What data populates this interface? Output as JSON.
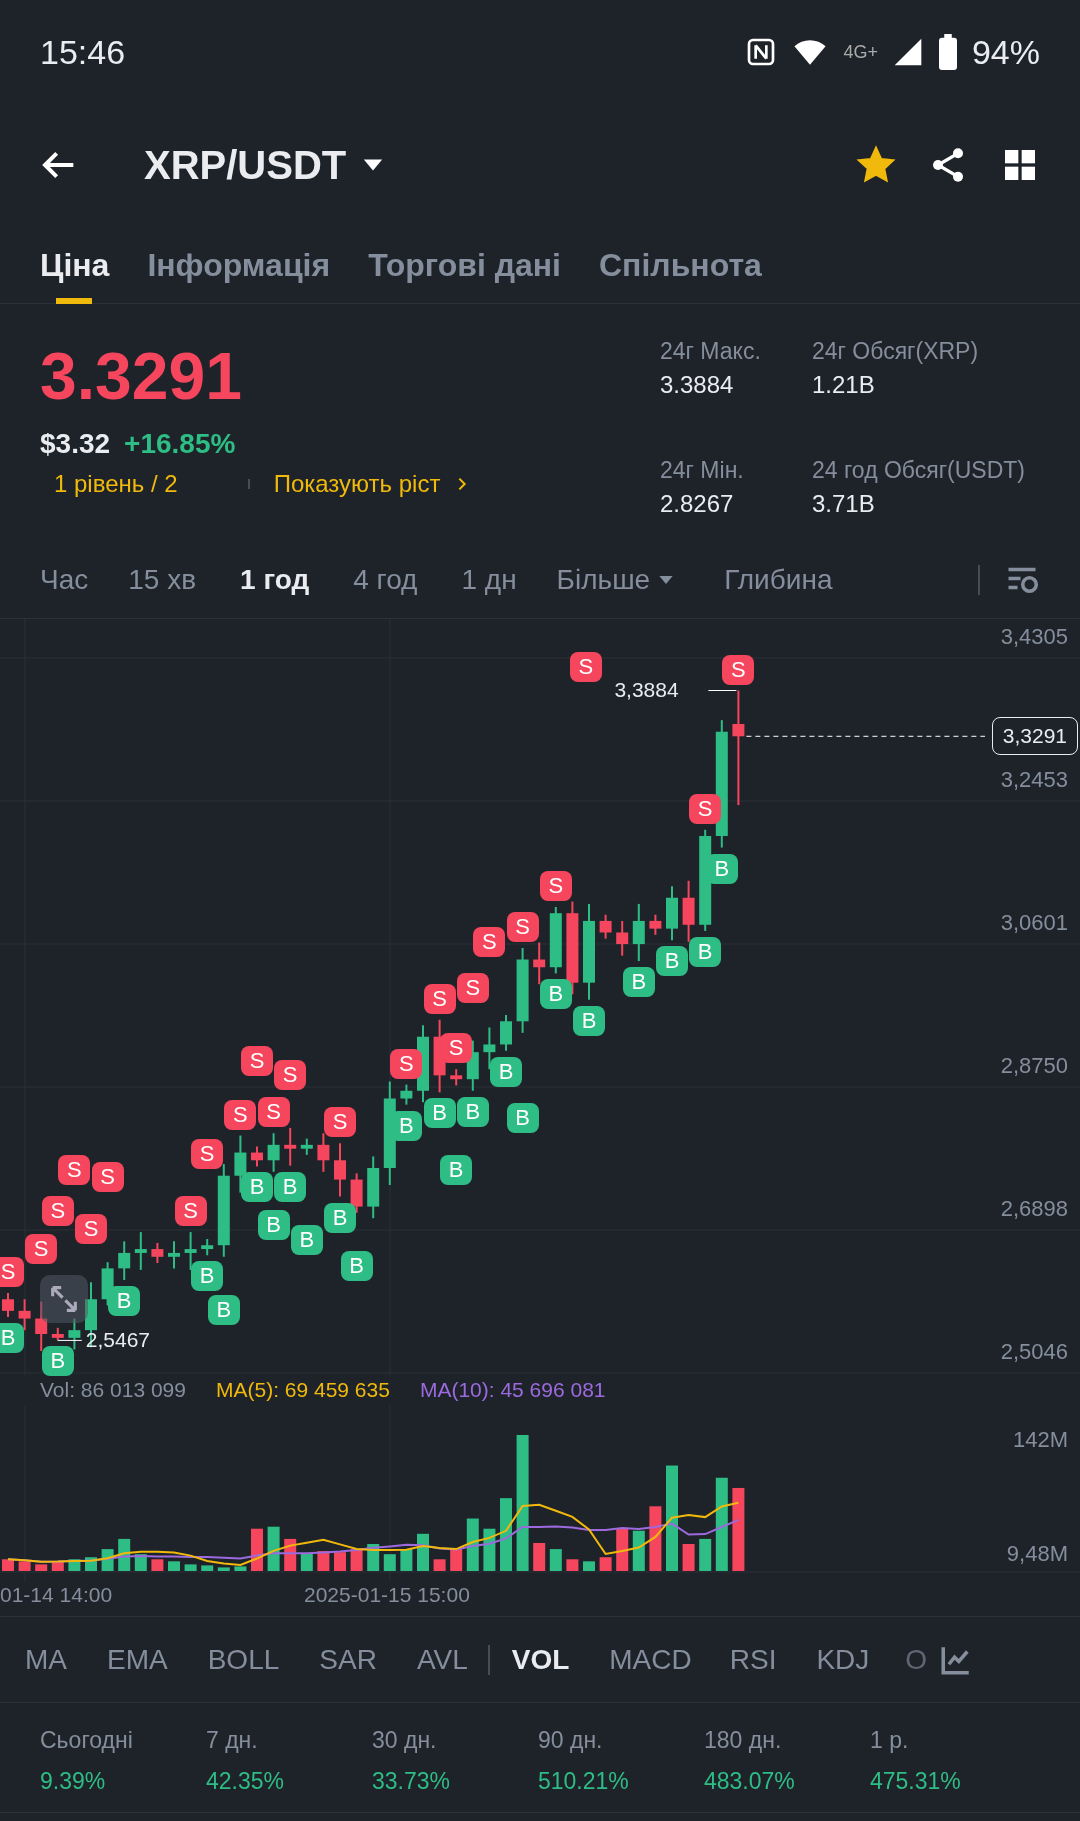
{
  "status_bar": {
    "time": "15:46",
    "network": "4G+",
    "battery": "94%"
  },
  "header": {
    "title": "XRP/USDT",
    "favorite": true
  },
  "tabs": [
    {
      "label": "Ціна",
      "selected": true
    },
    {
      "label": "Інформація",
      "selected": false
    },
    {
      "label": "Торгові дані",
      "selected": false
    },
    {
      "label": "Спільнота",
      "selected": false
    }
  ],
  "price": {
    "last": "3.3291",
    "usd": "$3.32",
    "change": "+16.85%",
    "level_text": "1 рівень / 2",
    "trend_link": "Показують ріст"
  },
  "stats": [
    {
      "label": "24г Макс.",
      "value": "3.3884"
    },
    {
      "label": "24г Обсяг(XRP)",
      "value": "1.21B"
    },
    {
      "label": "24г Мін.",
      "value": "2.8267"
    },
    {
      "label": "24 год Обсяг(USDT)",
      "value": "3.71B"
    }
  ],
  "intervals": [
    {
      "label": "Час",
      "selected": false
    },
    {
      "label": "15 хв",
      "selected": false
    },
    {
      "label": "1 год",
      "selected": true
    },
    {
      "label": "4 год",
      "selected": false
    },
    {
      "label": "1 дн",
      "selected": false
    },
    {
      "label": "Більше",
      "selected": false,
      "dropdown": true
    },
    {
      "label": "Глибина",
      "selected": false
    }
  ],
  "price_axis": [
    "3,4305",
    "3,2453",
    "3,0601",
    "2,8750",
    "2,6898",
    "2,5046"
  ],
  "current_price_tag": "3,3291",
  "high_label": "3,3884",
  "low_label": "2,5467",
  "trade_markers": [
    {
      "kind": "sell",
      "label": "S"
    },
    {
      "kind": "buy",
      "label": "B"
    },
    {
      "kind": "sell",
      "label": "S"
    },
    {
      "kind": "sell",
      "label": "S"
    },
    {
      "kind": "buy",
      "label": "B"
    },
    {
      "kind": "sell",
      "label": "S"
    },
    {
      "kind": "sell",
      "label": "S"
    },
    {
      "kind": "sell",
      "label": "S"
    },
    {
      "kind": "buy",
      "label": "B"
    },
    {
      "kind": "sell",
      "label": "S"
    },
    {
      "kind": "sell",
      "label": "S"
    },
    {
      "kind": "buy",
      "label": "B"
    },
    {
      "kind": "buy",
      "label": "B"
    },
    {
      "kind": "sell",
      "label": "S"
    },
    {
      "kind": "sell",
      "label": "S"
    },
    {
      "kind": "buy",
      "label": "B"
    },
    {
      "kind": "sell",
      "label": "S"
    },
    {
      "kind": "buy",
      "label": "B"
    },
    {
      "kind": "sell",
      "label": "S"
    },
    {
      "kind": "buy",
      "label": "B"
    },
    {
      "kind": "buy",
      "label": "B"
    },
    {
      "kind": "sell",
      "label": "S"
    },
    {
      "kind": "buy",
      "label": "B"
    },
    {
      "kind": "buy",
      "label": "B"
    },
    {
      "kind": "sell",
      "label": "S"
    },
    {
      "kind": "buy",
      "label": "B"
    },
    {
      "kind": "sell",
      "label": "S"
    },
    {
      "kind": "buy",
      "label": "B"
    },
    {
      "kind": "sell",
      "label": "S"
    },
    {
      "kind": "buy",
      "label": "B"
    },
    {
      "kind": "buy",
      "label": "B"
    },
    {
      "kind": "sell",
      "label": "S"
    },
    {
      "kind": "sell",
      "label": "S"
    },
    {
      "kind": "buy",
      "label": "B"
    },
    {
      "kind": "buy",
      "label": "B"
    },
    {
      "kind": "sell",
      "label": "S"
    },
    {
      "kind": "buy",
      "label": "B"
    },
    {
      "kind": "buy",
      "label": "B"
    },
    {
      "kind": "buy",
      "label": "B"
    },
    {
      "kind": "buy",
      "label": "B"
    },
    {
      "kind": "sell",
      "label": "S"
    },
    {
      "kind": "buy",
      "label": "B"
    },
    {
      "kind": "sell",
      "label": "S"
    },
    {
      "kind": "buy",
      "label": "B"
    },
    {
      "kind": "sell",
      "label": "S"
    },
    {
      "kind": "sell",
      "label": "S"
    }
  ],
  "volume_legend": {
    "vol": "Vol: 86 013 099",
    "ma5": "MA(5): 69 459 635",
    "ma10": "MA(10): 45 696 081"
  },
  "volume_axis": [
    "142M",
    "9,48M"
  ],
  "time_axis": [
    "01-14 14:00",
    "2025-01-15 15:00"
  ],
  "indicators": [
    {
      "label": "MA",
      "selected": false
    },
    {
      "label": "EMA",
      "selected": false
    },
    {
      "label": "BOLL",
      "selected": false
    },
    {
      "label": "SAR",
      "selected": false
    },
    {
      "label": "AVL",
      "selected": false
    },
    {
      "label": "VOL",
      "selected": true
    },
    {
      "label": "MACD",
      "selected": false
    },
    {
      "label": "RSI",
      "selected": false
    },
    {
      "label": "KDJ",
      "selected": false
    },
    {
      "label": "O",
      "selected": false
    }
  ],
  "performance": [
    {
      "period": "Сьогодні",
      "value": "9.39%"
    },
    {
      "period": "7 дн.",
      "value": "42.35%"
    },
    {
      "period": "30 дн.",
      "value": "33.73%"
    },
    {
      "period": "90 дн.",
      "value": "510.21%"
    },
    {
      "period": "180 дн.",
      "value": "483.07%"
    },
    {
      "period": "1 р.",
      "value": "475.31%"
    }
  ]
}
